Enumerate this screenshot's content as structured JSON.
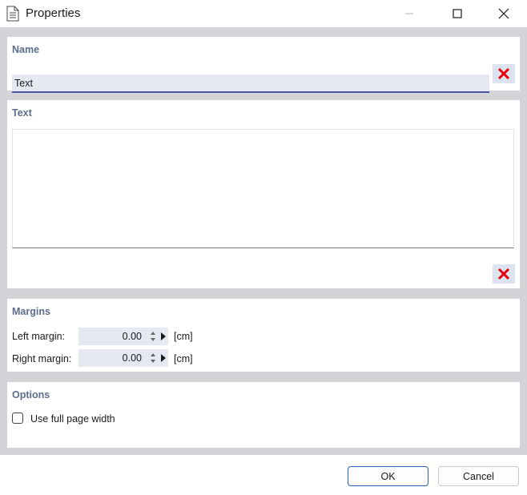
{
  "window": {
    "title": "Properties",
    "icon": "document-icon"
  },
  "name_section": {
    "title": "Name",
    "value": "Text",
    "placeholder": ""
  },
  "text_section": {
    "title": "Text",
    "value": ""
  },
  "margins": {
    "title": "Margins",
    "left_label": "Left margin:",
    "left_value": "0.00",
    "right_label": "Right margin:",
    "right_value": "0.00",
    "unit": "[cm]"
  },
  "options": {
    "title": "Options",
    "full_width_label": "Use full page width",
    "full_width_checked": false
  },
  "buttons": {
    "ok": "OK",
    "cancel": "Cancel"
  },
  "colors": {
    "accent": "#4a52a8",
    "clear_icon": "#e3000b",
    "section_title": "#5a6d8c"
  }
}
